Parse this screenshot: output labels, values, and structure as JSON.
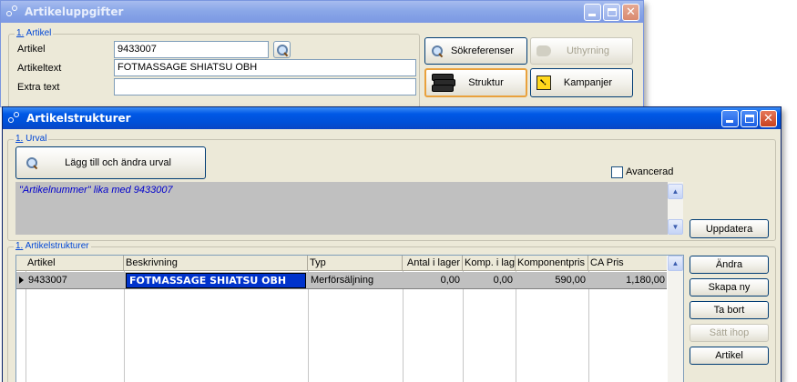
{
  "back_window": {
    "title": "Artikeluppgifter",
    "group_label_prefix": "1.",
    "group_label": "Artikel",
    "fields": {
      "artikel_label": "Artikel",
      "artikel_value": "9433007",
      "artikeltext_label": "Artikeltext",
      "artikeltext_value": "FOTMASSAGE SHIATSU OBH",
      "extra_text_label": "Extra text",
      "extra_text_value": ""
    },
    "buttons": {
      "sokreferenser": "Sökreferenser",
      "uthyrning": "Uthyrning",
      "struktur": "Struktur",
      "kampanjer": "Kampanjer"
    }
  },
  "front_window": {
    "title": "Artikelstrukturer",
    "urval": {
      "group_label_prefix": "1.",
      "group_label": "Urval",
      "add_button": "Lägg till och ändra urval",
      "advanced_label": "Avancerad",
      "advanced_checked": false,
      "criteria_text": "\"Artikelnummer\" lika med 9433007",
      "update_button": "Uppdatera"
    },
    "structures": {
      "group_label_prefix": "1.",
      "group_label": "Artikelstrukturer",
      "columns": [
        "Artikel",
        "Beskrivning",
        "Typ",
        "Antal i lager",
        "Komp. i lager",
        "Komponentpris",
        "CA Pris"
      ],
      "rows": [
        {
          "artikel": "9433007",
          "beskrivning": "FOTMASSAGE SHIATSU OBH",
          "typ": "Merförsäljning",
          "antal_i_lager": "0,00",
          "komp_i_lager": "0,00",
          "komponentpris": "590,00",
          "ca_pris": "1,180,00"
        }
      ]
    },
    "side_buttons": {
      "andra": "Ändra",
      "skapa_ny": "Skapa ny",
      "ta_bort": "Ta bort",
      "satt_ihop": "Sätt ihop",
      "artikel": "Artikel"
    }
  },
  "colors": {
    "active_titlebar": "#0058e6",
    "inactive_titlebar": "#8aa7e8",
    "group_label": "#0046d5",
    "criteria_text": "#0000cc",
    "edit_cell": "#0033cc",
    "window_face": "#ece9d8"
  }
}
